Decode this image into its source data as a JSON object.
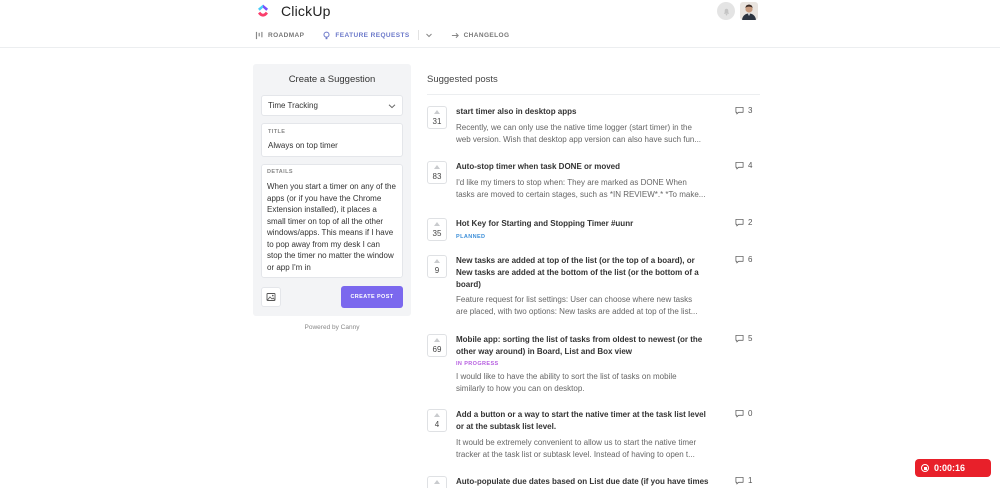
{
  "header": {
    "brand": "ClickUp",
    "nav": [
      {
        "label": "ROADMAP",
        "icon": "roadmap-icon"
      },
      {
        "label": "FEATURE REQUESTS",
        "icon": "lightbulb-icon",
        "active": true
      },
      {
        "label": "CHANGELOG",
        "icon": "arrow-right-icon"
      }
    ]
  },
  "form": {
    "title": "Create a Suggestion",
    "board": "Time Tracking",
    "title_label": "TITLE",
    "title_value": "Always on top timer",
    "details_label": "DETAILS",
    "details_value": "When you start a timer on any of the apps (or if you have the Chrome Extension installed), it places a small timer on top of all the other windows/apps. This means if I have to pop away from my desk I can stop the timer no matter the window or app I'm in",
    "submit": "CREATE POST",
    "powered": "Powered by Canny"
  },
  "posts": {
    "heading": "Suggested posts",
    "items": [
      {
        "votes": "31",
        "title": "start timer also in desktop apps",
        "status": "",
        "desc_1": "Recently, we can only use the native time logger (start timer) in the",
        "desc_2": "web version. Wish that desktop app version can also have such fun...",
        "comments": "3"
      },
      {
        "votes": "83",
        "title": "Auto-stop timer when task DONE or moved",
        "status": "",
        "desc_1": "I'd like my timers to stop when: They are marked as DONE When",
        "desc_2": "tasks are moved to certain stages, such as *IN REVIEW*.* *To make...",
        "comments": "4"
      },
      {
        "votes": "35",
        "title": "Hot Key for Starting and Stopping Timer #uunr",
        "status": "PLANNED",
        "desc_1": "",
        "desc_2": "",
        "comments": "2"
      },
      {
        "votes": "9",
        "title_1": "New tasks are added at top of the list (or the top of a board), or",
        "title_2": "New tasks are added at the bottom of the list (or the bottom of a",
        "title_3": "board)",
        "status": "",
        "desc_1": "Feature request for list settings: User can choose where new tasks",
        "desc_2": "are placed, with two options: New tasks are added at top of the list...",
        "comments": "6"
      },
      {
        "votes": "69",
        "title_1": "Mobile app: sorting the list of tasks from oldest to newest (or the",
        "title_2": "other way around) in Board, List and Box view",
        "status": "IN PROGRESS",
        "desc_1": "I would like to have the ability to sort the list of tasks on mobile",
        "desc_2": "similarly to how you can on desktop.",
        "comments": "5"
      },
      {
        "votes": "4",
        "title_1": "Add a button or a way to start the native timer at the task list level",
        "title_2": "or at the subtask list level.",
        "status": "",
        "desc_1": "It would be extremely convenient to allow us to start the native timer",
        "desc_2": "tracker at the task list or subtask level. Instead of having to open t...",
        "comments": "0"
      },
      {
        "votes": "",
        "title": "Auto-populate due dates based on List due date (if you have times",
        "status": "",
        "desc_1": "",
        "desc_2": "",
        "comments": "1"
      }
    ]
  },
  "timer": {
    "value": "0:00:16"
  },
  "colors": {
    "accent": "#7b68ee",
    "planned": "#3d8fd9",
    "in_progress": "#b65ee0",
    "timer": "#e8202a"
  }
}
